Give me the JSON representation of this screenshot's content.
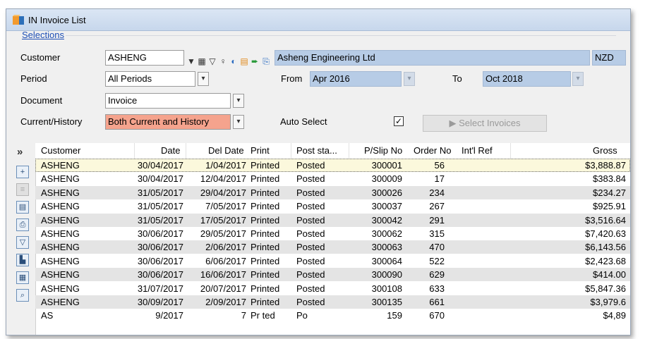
{
  "window": {
    "title": "IN Invoice List"
  },
  "selections": {
    "legend": "Selections",
    "customer": {
      "label": "Customer",
      "code": "ASHENG",
      "name": "Asheng Engineering Ltd",
      "currency": "NZD"
    },
    "period": {
      "label": "Period",
      "value": "All Periods",
      "from_label": "From",
      "from": "Apr 2016",
      "to_label": "To",
      "to": "Oct 2018"
    },
    "document": {
      "label": "Document",
      "value": "Invoice"
    },
    "current_history": {
      "label": "Current/History",
      "value": "Both Current and History"
    },
    "auto_select": {
      "label": "Auto Select",
      "checked": true,
      "mark": "✓"
    },
    "select_button": {
      "icon": "▶",
      "label": "Select Invoices"
    }
  },
  "grid": {
    "expand_icon": "»",
    "columns": [
      "Customer",
      "Date",
      "Del Date",
      "Print",
      "Post sta...",
      "P/Slip No",
      "Order No",
      "Int'l Ref",
      "Gross"
    ],
    "rows": [
      {
        "customer": "ASHENG",
        "date": "30/04/2017",
        "del_date": "1/04/2017",
        "print": "Printed",
        "post": "Posted",
        "pslip": "300001",
        "order": "56",
        "ref": "",
        "gross": "$3,888.87"
      },
      {
        "customer": "ASHENG",
        "date": "30/04/2017",
        "del_date": "12/04/2017",
        "print": "Printed",
        "post": "Posted",
        "pslip": "300009",
        "order": "17",
        "ref": "",
        "gross": "$383.84"
      },
      {
        "customer": "ASHENG",
        "date": "31/05/2017",
        "del_date": "29/04/2017",
        "print": "Printed",
        "post": "Posted",
        "pslip": "300026",
        "order": "234",
        "ref": "",
        "gross": "$234.27"
      },
      {
        "customer": "ASHENG",
        "date": "31/05/2017",
        "del_date": "7/05/2017",
        "print": "Printed",
        "post": "Posted",
        "pslip": "300037",
        "order": "267",
        "ref": "",
        "gross": "$925.91"
      },
      {
        "customer": "ASHENG",
        "date": "31/05/2017",
        "del_date": "17/05/2017",
        "print": "Printed",
        "post": "Posted",
        "pslip": "300042",
        "order": "291",
        "ref": "",
        "gross": "$3,516.64"
      },
      {
        "customer": "ASHENG",
        "date": "30/06/2017",
        "del_date": "29/05/2017",
        "print": "Printed",
        "post": "Posted",
        "pslip": "300062",
        "order": "315",
        "ref": "",
        "gross": "$7,420.63"
      },
      {
        "customer": "ASHENG",
        "date": "30/06/2017",
        "del_date": "2/06/2017",
        "print": "Printed",
        "post": "Posted",
        "pslip": "300063",
        "order": "470",
        "ref": "",
        "gross": "$6,143.56"
      },
      {
        "customer": "ASHENG",
        "date": "30/06/2017",
        "del_date": "6/06/2017",
        "print": "Printed",
        "post": "Posted",
        "pslip": "300064",
        "order": "522",
        "ref": "",
        "gross": "$2,423.68"
      },
      {
        "customer": "ASHENG",
        "date": "30/06/2017",
        "del_date": "16/06/2017",
        "print": "Printed",
        "post": "Posted",
        "pslip": "300090",
        "order": "629",
        "ref": "",
        "gross": "$414.00"
      },
      {
        "customer": "ASHENG",
        "date": "31/07/2017",
        "del_date": "20/07/2017",
        "print": "Printed",
        "post": "Posted",
        "pslip": "300108",
        "order": "633",
        "ref": "",
        "gross": "$5,847.36"
      },
      {
        "customer": "ASHENG",
        "date": "30/09/2017",
        "del_date": "2/09/2017",
        "print": "Printed",
        "post": "Posted",
        "pslip": "300135",
        "order": "661",
        "ref": "",
        "gross": "$3,979.6"
      },
      {
        "customer": "AS",
        "date": "9/2017",
        "del_date": "7",
        "print": "Pr  ted",
        "post": "Po",
        "pslip": "159",
        "order": "670",
        "ref": "",
        "gross": "$4,89"
      }
    ]
  },
  "colors": {
    "readonly": "#b7cce6",
    "highlight": "#f5a38d",
    "selected_row": "#fbf8dc",
    "legend": "#1e4fb5"
  }
}
